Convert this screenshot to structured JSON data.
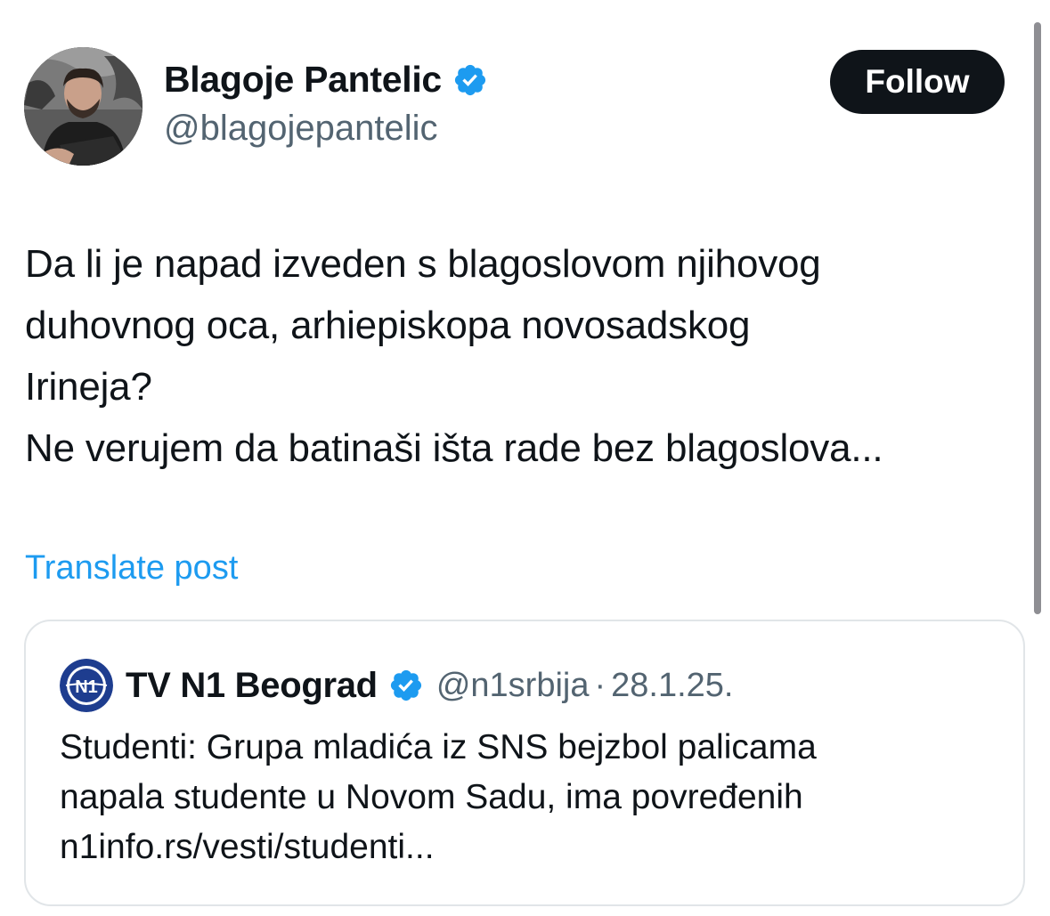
{
  "author": {
    "display_name": "Blagoje Pantelic",
    "handle": "@blagojepantelic",
    "verified_icon": "verified-badge-icon"
  },
  "follow_button": {
    "label": "Follow"
  },
  "post": {
    "lines": [
      "Da li je napad izveden s blagoslovom njihovog",
      "duhovnog oca, arhiepiskopa novosadskog",
      "Irineja?",
      "Ne verujem da batinaši išta rade bez blagoslova..."
    ],
    "translate_label": "Translate post"
  },
  "quote": {
    "logo_text": "N1",
    "display_name": "TV N1 Beograd",
    "handle": "@n1srbija",
    "separator": "·",
    "date": "28.1.25.",
    "lines": [
      "Studenti: Grupa mladića iz SNS bejzbol palicama",
      "napala studente u Novom Sadu, ima povređenih",
      "n1info.rs/vesti/studenti..."
    ]
  },
  "colors": {
    "accent_link": "#1d9bf0",
    "verified_blue": "#1d9bf0",
    "secondary_text": "#536471",
    "follow_bg": "#0f1419",
    "n1_logo_bg": "#1e3d8f"
  }
}
